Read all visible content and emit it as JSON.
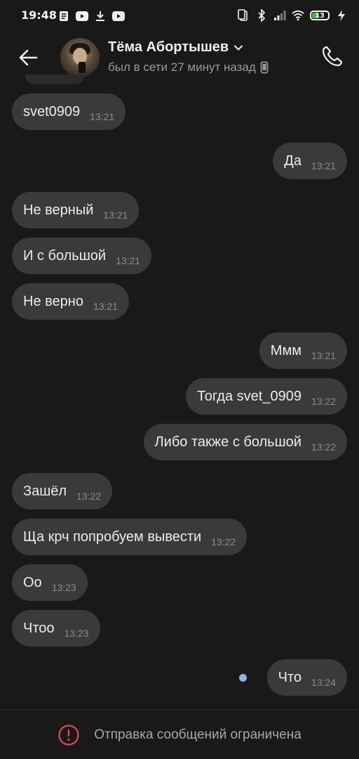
{
  "status_bar": {
    "time": "19:48",
    "battery": "13",
    "left_icons": [
      "document-icon",
      "youtube-icon",
      "download-icon",
      "youtube-icon"
    ],
    "right_icons": [
      "vibrate-icon",
      "bluetooth-icon",
      "signal-icon",
      "wifi-icon",
      "battery-icon",
      "charging-icon"
    ]
  },
  "header": {
    "contact_name": "Тёма Абортышев",
    "last_seen": "был в сети 27 минут назад"
  },
  "messages": [
    {
      "direction": "in",
      "text": "svet0909",
      "time": "13:21"
    },
    {
      "direction": "out",
      "text": "Да",
      "time": "13:21"
    },
    {
      "direction": "in",
      "text": "Не верный",
      "time": "13:21"
    },
    {
      "direction": "in",
      "text": "И с большой",
      "time": "13:21"
    },
    {
      "direction": "in",
      "text": "Не верно",
      "time": "13:21"
    },
    {
      "direction": "out",
      "text": "Ммм",
      "time": "13:21"
    },
    {
      "direction": "out",
      "text": "Тогда svet_0909",
      "time": "13:22"
    },
    {
      "direction": "out",
      "text": "Либо также с большой",
      "time": "13:22"
    },
    {
      "direction": "in",
      "text": "Зашёл",
      "time": "13:22"
    },
    {
      "direction": "in",
      "text": "Ща крч попробуем вывести",
      "time": "13:22"
    },
    {
      "direction": "in",
      "text": "Оо",
      "time": "13:23"
    },
    {
      "direction": "in",
      "text": "Чтоо",
      "time": "13:23"
    },
    {
      "direction": "out",
      "text": "Что",
      "time": "13:24"
    }
  ],
  "bottom_bar": {
    "text": "Отправка сообщений ограничена"
  },
  "colors": {
    "background": "#19191a",
    "bubble": "#3a3a3c",
    "unread_dot": "#8fb4dd",
    "warning": "#e5484d"
  }
}
